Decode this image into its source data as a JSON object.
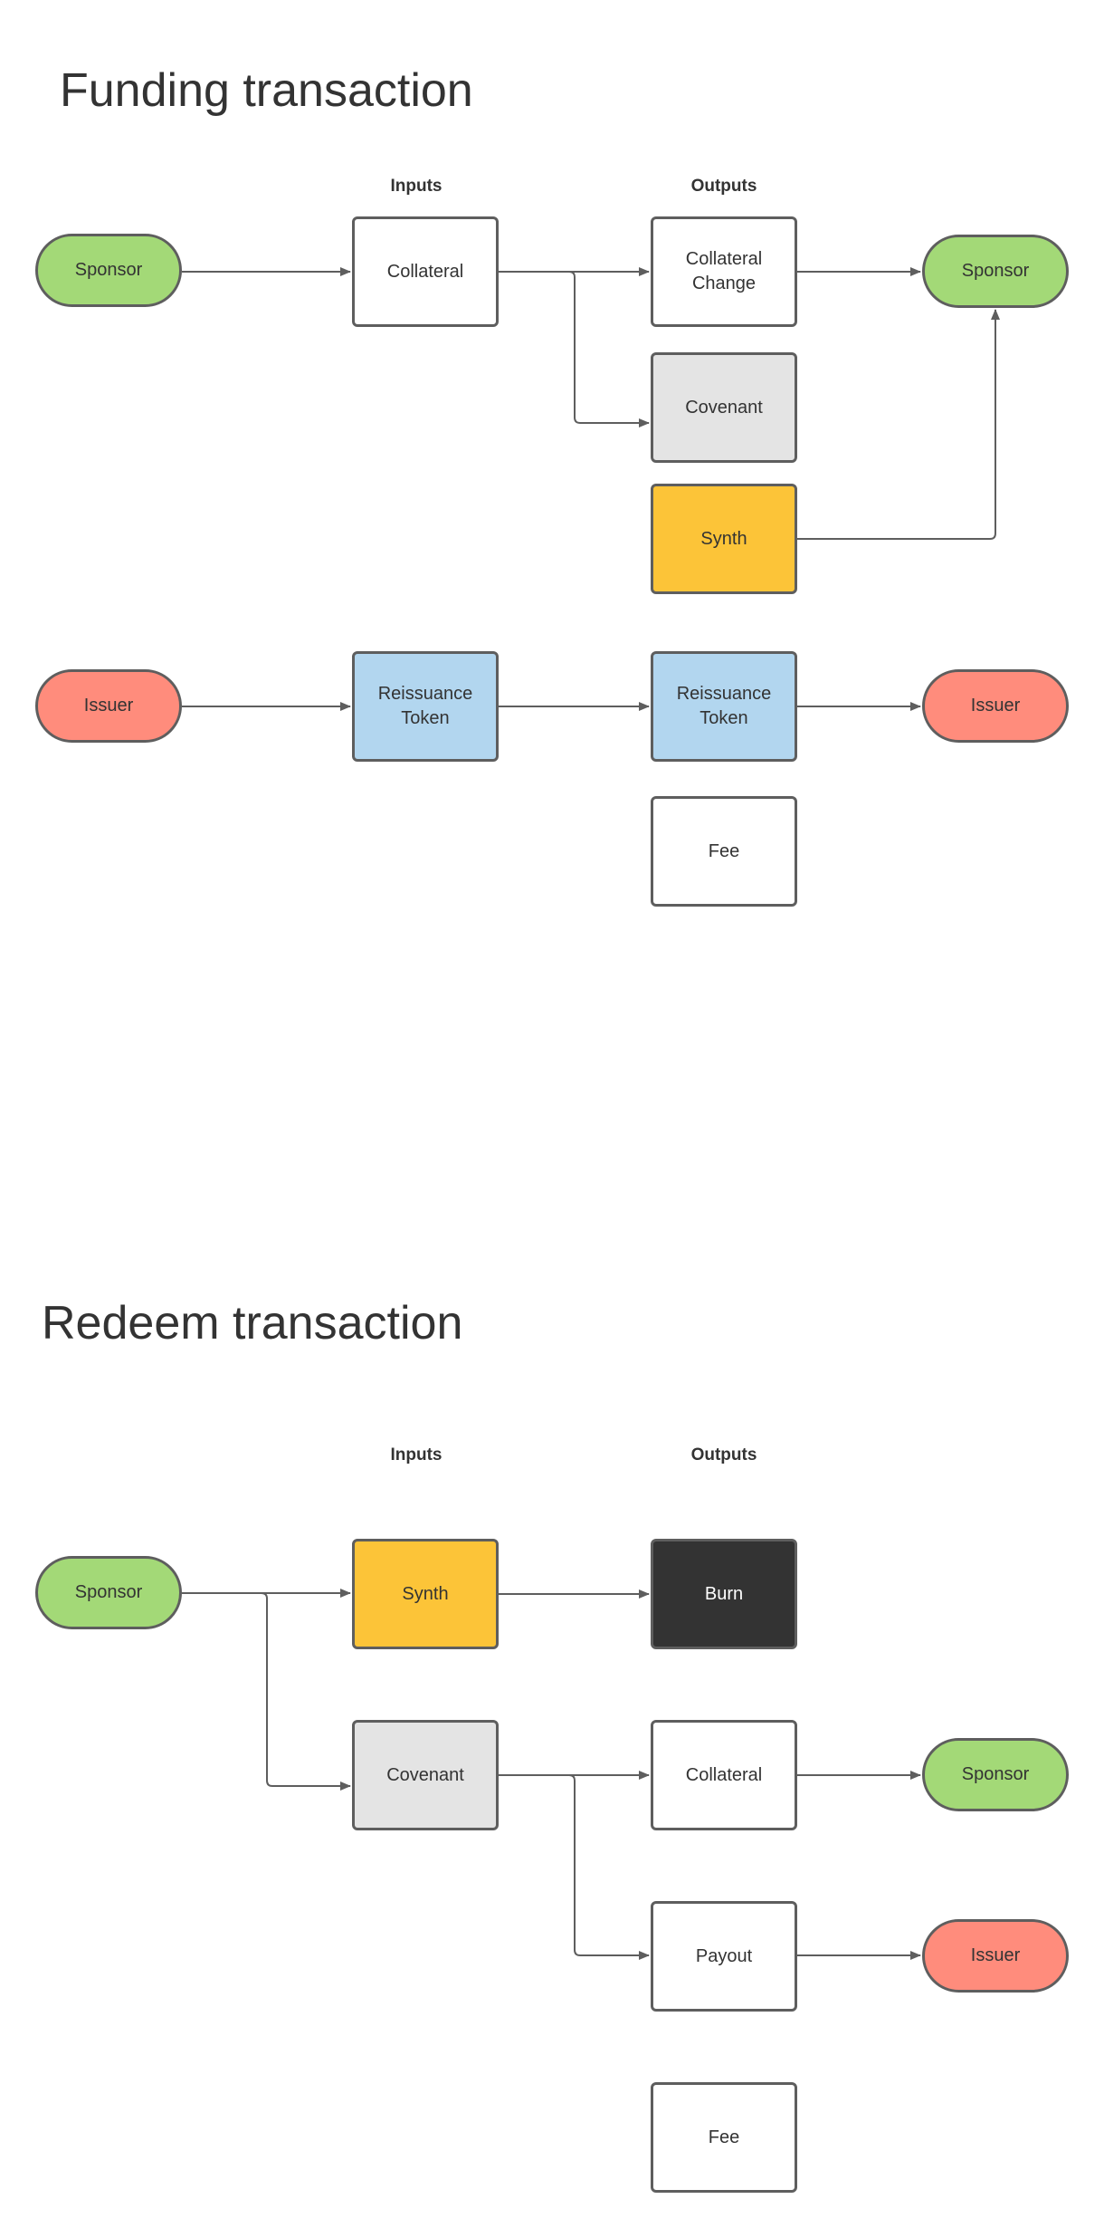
{
  "funding": {
    "title": "Funding transaction",
    "inputs_label": "Inputs",
    "outputs_label": "Outputs",
    "nodes": {
      "sponsor_in": "Sponsor",
      "collateral_in": "Collateral",
      "collateral_change_out": "Collateral\nChange",
      "covenant_out": "Covenant",
      "synth_out": "Synth",
      "sponsor_out": "Sponsor",
      "issuer_in": "Issuer",
      "reissuance_in": "Reissuance\nToken",
      "reissuance_out": "Reissuance\nToken",
      "issuer_out": "Issuer",
      "fee_out": "Fee"
    }
  },
  "redeem": {
    "title": "Redeem transaction",
    "inputs_label": "Inputs",
    "outputs_label": "Outputs",
    "nodes": {
      "sponsor_in": "Sponsor",
      "synth_in": "Synth",
      "covenant_in": "Covenant",
      "burn_out": "Burn",
      "collateral_out": "Collateral",
      "payout_out": "Payout",
      "fee_out": "Fee",
      "sponsor_out": "Sponsor",
      "issuer_out": "Issuer"
    }
  },
  "colors": {
    "sponsor": "#a3d977",
    "issuer": "#ff8c7c",
    "reissuance_token": "#b2d6ef",
    "synth": "#fcc438",
    "covenant": "#e4e4e4",
    "burn": "#333333",
    "connector": "#5e5e5e"
  }
}
